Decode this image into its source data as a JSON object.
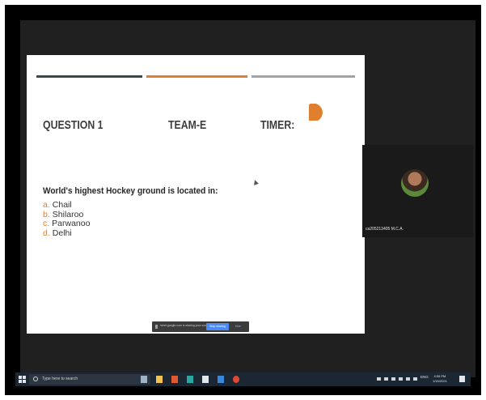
{
  "slide": {
    "question_label": "QUESTION 1",
    "team_label": "TEAM-E",
    "timer_label": "TIMER:",
    "question_text": "World's highest Hockey ground is located in:",
    "options": [
      {
        "letter": "a.",
        "text": "Chail"
      },
      {
        "letter": "b.",
        "text": "Shilaroo"
      },
      {
        "letter": "c.",
        "text": "Parwanoo"
      },
      {
        "letter": "d.",
        "text": "Delhi"
      }
    ],
    "accent_color": "#e07f2e"
  },
  "share_notice": {
    "message": "meet.google.com is sharing your screen.",
    "stop_label": "Stop sharing",
    "hide_label": "Hide"
  },
  "participant": {
    "name": "ca205213405 M.C.A."
  },
  "taskbar": {
    "search_placeholder": "Type here to search",
    "language": "ENG",
    "region": "IN",
    "time": "4:55 PM",
    "date": "1/15/2021"
  }
}
